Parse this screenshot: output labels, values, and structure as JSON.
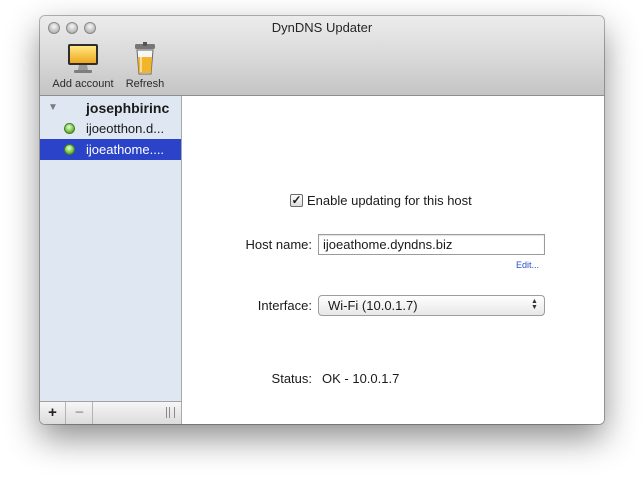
{
  "window": {
    "title": "DynDNS Updater"
  },
  "toolbar": {
    "add_account": "Add account",
    "refresh": "Refresh"
  },
  "sidebar": {
    "group": "josephbirinc",
    "hosts": [
      {
        "label": "ijoeotthon.d...",
        "status": "green",
        "selected": false
      },
      {
        "label": "ijoeathome....",
        "status": "green",
        "selected": true
      }
    ],
    "add_label": "+",
    "remove_label": "−"
  },
  "detail": {
    "enable_checked": true,
    "enable_label": "Enable updating for this host",
    "host_label": "Host name:",
    "host_value": "ijoeathome.dyndns.biz",
    "edit_label": "Edit...",
    "interface_label": "Interface:",
    "interface_value": "Wi-Fi (10.0.1.7)",
    "status_label": "Status:",
    "status_value": "OK - 10.0.1.7"
  },
  "colors": {
    "selection": "#2a43c9",
    "status_ok": "#7fc34e",
    "link": "#2b4ec9"
  }
}
